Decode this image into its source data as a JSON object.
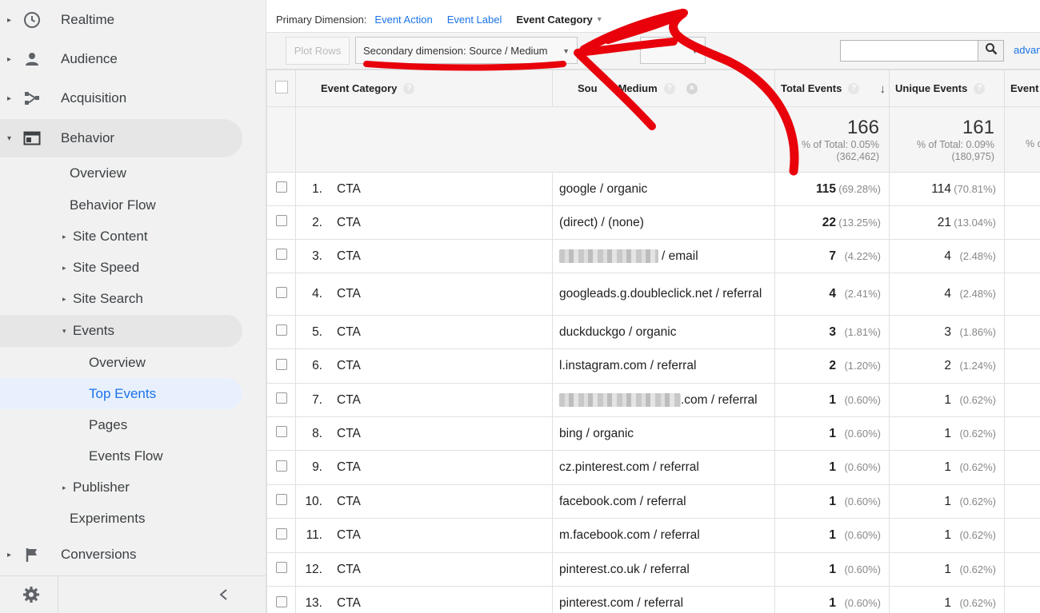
{
  "sidebar": {
    "top_items": [
      {
        "label": "Realtime",
        "icon": "clock-icon"
      },
      {
        "label": "Audience",
        "icon": "person-icon"
      },
      {
        "label": "Acquisition",
        "icon": "acquisition-icon"
      },
      {
        "label": "Behavior",
        "icon": "behavior-icon"
      },
      {
        "label": "Conversions",
        "icon": "flag-icon"
      }
    ],
    "behavior_children": {
      "overview": "Overview",
      "behavior_flow": "Behavior Flow",
      "site_content": "Site Content",
      "site_speed": "Site Speed",
      "site_search": "Site Search",
      "events": "Events",
      "events_children": [
        "Overview",
        "Top Events",
        "Pages",
        "Events Flow"
      ],
      "publisher": "Publisher",
      "experiments": "Experiments"
    },
    "selected": "Top Events",
    "accent_color": "#1a73e8"
  },
  "primary_dimension": {
    "label": "Primary Dimension:",
    "options": [
      "Event Action",
      "Event Label"
    ],
    "current": "Event Category"
  },
  "toolbar": {
    "plot_rows": "Plot Rows",
    "secondary_dimension": "Secondary dimension: Source / Medium",
    "advanced": "advan"
  },
  "table": {
    "columns": [
      "Event Category",
      "Source / Medium",
      "Total Events",
      "Unique Events",
      "Event V"
    ],
    "source_header_visible": [
      "Sou",
      "Medium"
    ],
    "totals": {
      "total_events": "166",
      "total_events_pct": "% of Total: 0.05%",
      "total_events_base": "(362,462)",
      "unique_events": "161",
      "unique_events_pct": "% of Total: 0.09%",
      "unique_events_base": "(180,975)",
      "event_value_partial": "% o"
    },
    "rows": [
      {
        "n": "1.",
        "cat": "CTA",
        "src": "google / organic",
        "te": "115",
        "tep": "(69.28%)",
        "ue": "114",
        "uep": "(70.81%)"
      },
      {
        "n": "2.",
        "cat": "CTA",
        "src": "(direct) / (none)",
        "te": "22",
        "tep": "(13.25%)",
        "ue": "21",
        "uep": "(13.04%)"
      },
      {
        "n": "3.",
        "cat": "CTA",
        "src": "/ email",
        "te": "7",
        "tep": "(4.22%)",
        "ue": "4",
        "uep": "(2.48%)"
      },
      {
        "n": "4.",
        "cat": "CTA",
        "src": "googleads.g.doubleclick.net / referral",
        "te": "4",
        "tep": "(2.41%)",
        "ue": "4",
        "uep": "(2.48%)"
      },
      {
        "n": "5.",
        "cat": "CTA",
        "src": "duckduckgo / organic",
        "te": "3",
        "tep": "(1.81%)",
        "ue": "3",
        "uep": "(1.86%)"
      },
      {
        "n": "6.",
        "cat": "CTA",
        "src": "l.instagram.com / referral",
        "te": "2",
        "tep": "(1.20%)",
        "ue": "2",
        "uep": "(1.24%)"
      },
      {
        "n": "7.",
        "cat": "CTA",
        "src": ".com / referral",
        "te": "1",
        "tep": "(0.60%)",
        "ue": "1",
        "uep": "(0.62%)"
      },
      {
        "n": "8.",
        "cat": "CTA",
        "src": "bing / organic",
        "te": "1",
        "tep": "(0.60%)",
        "ue": "1",
        "uep": "(0.62%)"
      },
      {
        "n": "9.",
        "cat": "CTA",
        "src": "cz.pinterest.com / referral",
        "te": "1",
        "tep": "(0.60%)",
        "ue": "1",
        "uep": "(0.62%)"
      },
      {
        "n": "10.",
        "cat": "CTA",
        "src": "facebook.com / referral",
        "te": "1",
        "tep": "(0.60%)",
        "ue": "1",
        "uep": "(0.62%)"
      },
      {
        "n": "11.",
        "cat": "CTA",
        "src": "m.facebook.com / referral",
        "te": "1",
        "tep": "(0.60%)",
        "ue": "1",
        "uep": "(0.62%)"
      },
      {
        "n": "12.",
        "cat": "CTA",
        "src": "pinterest.co.uk / referral",
        "te": "1",
        "tep": "(0.60%)",
        "ue": "1",
        "uep": "(0.62%)"
      },
      {
        "n": "13.",
        "cat": "CTA",
        "src": "pinterest.com / referral",
        "te": "1",
        "tep": "(0.60%)",
        "ue": "1",
        "uep": "(0.62%)"
      }
    ]
  },
  "annotation": {
    "color": "#e8000b"
  }
}
